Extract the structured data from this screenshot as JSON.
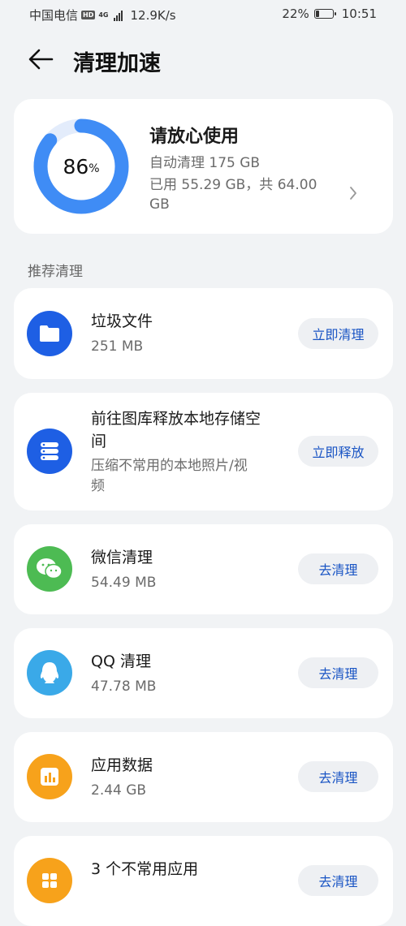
{
  "status_bar": {
    "carrier": "中国电信",
    "hd": "HD",
    "net_type": "4G",
    "speed": "12.9K/s",
    "battery_percent": "22%",
    "battery_level": 0.22,
    "time": "10:51"
  },
  "header": {
    "title": "清理加速"
  },
  "summary": {
    "percent_value": 86,
    "percent_number": "86",
    "percent_sign": "%",
    "status": "请放心使用",
    "auto_clean": "自动清理 175 GB",
    "usage_line1": "已用 55.29 GB，共 64.00",
    "usage_line2": "GB",
    "colors": {
      "ring": "#3f8cf5",
      "track": "#e3ecfb"
    }
  },
  "section_title": "推荐清理",
  "items": [
    {
      "name": "垃圾文件",
      "sub": "251 MB",
      "button": "立即清理",
      "icon": "folder-icon",
      "color": "#1e5fe4"
    },
    {
      "name_line1": "前往图库释放本地存储空",
      "name_line2": "间",
      "sub_line1": "压缩不常用的本地照片/视",
      "sub_line2": "频",
      "button": "立即释放",
      "icon": "storage-icon",
      "color": "#1e5fe4"
    },
    {
      "name": "微信清理",
      "sub": "54.49 MB",
      "button": "去清理",
      "icon": "wechat-icon",
      "color": "#4dbb53"
    },
    {
      "name": "QQ 清理",
      "sub": "47.78 MB",
      "button": "去清理",
      "icon": "qq-icon",
      "color": "#3aa9e8"
    },
    {
      "name": "应用数据",
      "sub": "2.44 GB",
      "button": "去清理",
      "icon": "app-data-icon",
      "color": "#f7a21b"
    },
    {
      "name": "3 个不常用应用",
      "button": "去清理",
      "icon": "apps-icon",
      "color": "#f7a21b"
    }
  ]
}
